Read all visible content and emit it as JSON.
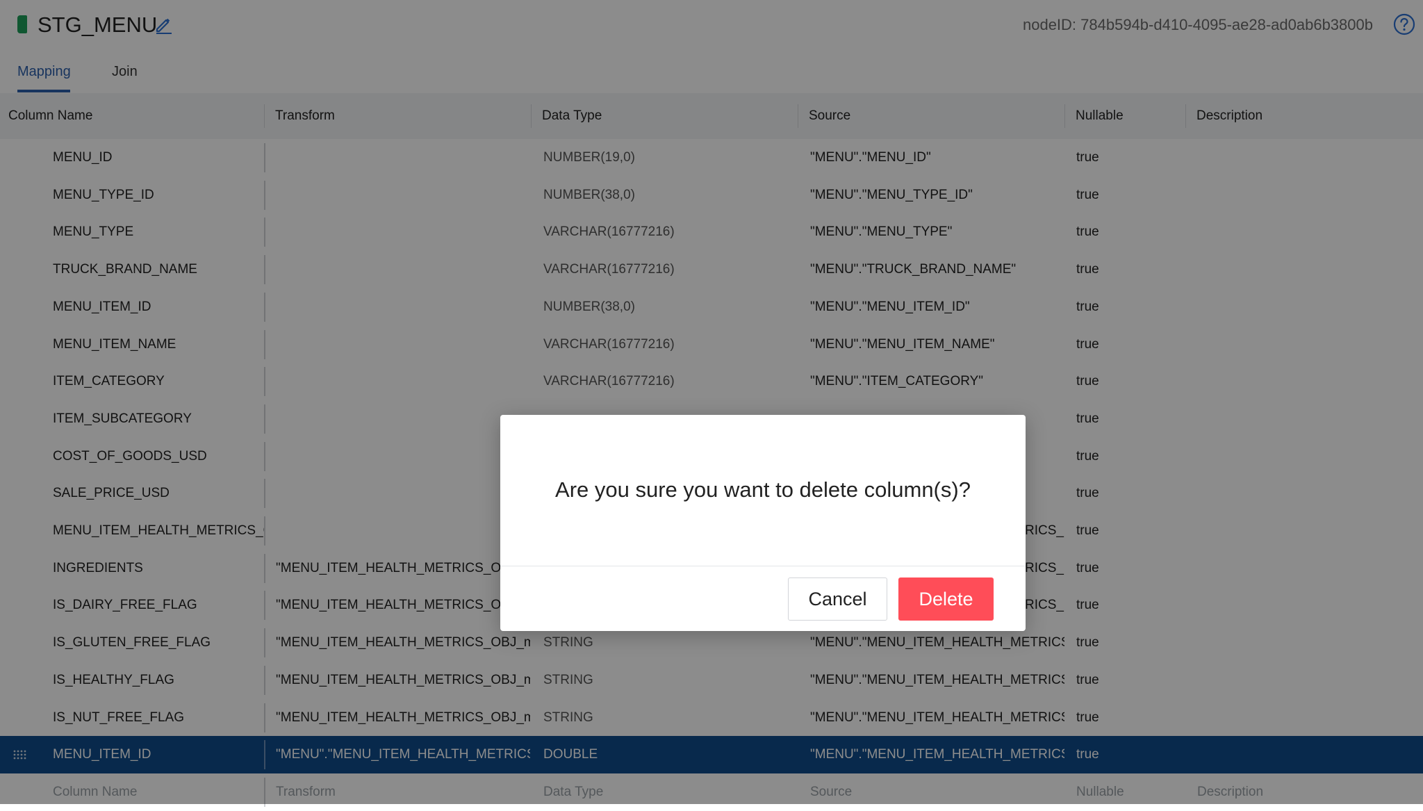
{
  "header": {
    "title": "STG_MENU",
    "node_id": "nodeID: 784b594b-d410-4095-ae28-ad0ab6b3800b",
    "accent_color": "#1e9e5a",
    "edit_icon": "pencil-icon",
    "help_icon": "help-circle-icon"
  },
  "tabs": [
    {
      "label": "Mapping",
      "active": true
    },
    {
      "label": "Join",
      "active": false
    }
  ],
  "table": {
    "columns": [
      "Column Name",
      "Transform",
      "Data Type",
      "Source",
      "Nullable",
      "Description"
    ],
    "rows": [
      {
        "name": "MENU_ID",
        "transform": "",
        "type": "NUMBER(19,0)",
        "source": "\"MENU\".\"MENU_ID\"",
        "nullable": "true",
        "description": ""
      },
      {
        "name": "MENU_TYPE_ID",
        "transform": "",
        "type": "NUMBER(38,0)",
        "source": "\"MENU\".\"MENU_TYPE_ID\"",
        "nullable": "true",
        "description": ""
      },
      {
        "name": "MENU_TYPE",
        "transform": "",
        "type": "VARCHAR(16777216)",
        "source": "\"MENU\".\"MENU_TYPE\"",
        "nullable": "true",
        "description": ""
      },
      {
        "name": "TRUCK_BRAND_NAME",
        "transform": "",
        "type": "VARCHAR(16777216)",
        "source": "\"MENU\".\"TRUCK_BRAND_NAME\"",
        "nullable": "true",
        "description": ""
      },
      {
        "name": "MENU_ITEM_ID",
        "transform": "",
        "type": "NUMBER(38,0)",
        "source": "\"MENU\".\"MENU_ITEM_ID\"",
        "nullable": "true",
        "description": ""
      },
      {
        "name": "MENU_ITEM_NAME",
        "transform": "",
        "type": "VARCHAR(16777216)",
        "source": "\"MENU\".\"MENU_ITEM_NAME\"",
        "nullable": "true",
        "description": ""
      },
      {
        "name": "ITEM_CATEGORY",
        "transform": "",
        "type": "VARCHAR(16777216)",
        "source": "\"MENU\".\"ITEM_CATEGORY\"",
        "nullable": "true",
        "description": ""
      },
      {
        "name": "ITEM_SUBCATEGORY",
        "transform": "",
        "type": "",
        "source": "",
        "nullable": "true",
        "description": ""
      },
      {
        "name": "COST_OF_GOODS_USD",
        "transform": "",
        "type": "",
        "source": "",
        "nullable": "true",
        "description": ""
      },
      {
        "name": "SALE_PRICE_USD",
        "transform": "",
        "type": "",
        "source": "",
        "nullable": "true",
        "description": ""
      },
      {
        "name": "MENU_ITEM_HEALTH_METRICS_OE",
        "transform": "",
        "type": "",
        "source": "RICS_(",
        "nullable": "true",
        "description": ""
      },
      {
        "name": "INGREDIENTS",
        "transform": "\"MENU_ITEM_HEALTH_METRICS_OBJ",
        "type": "",
        "source": "RICS_(",
        "nullable": "true",
        "description": ""
      },
      {
        "name": "IS_DAIRY_FREE_FLAG",
        "transform": "\"MENU_ITEM_HEALTH_METRICS_OBJ",
        "type": "",
        "source": "RICS_(",
        "nullable": "true",
        "description": ""
      },
      {
        "name": "IS_GLUTEN_FREE_FLAG",
        "transform": "\"MENU_ITEM_HEALTH_METRICS_OBJ_mer",
        "type": "STRING",
        "source": "\"MENU\".\"MENU_ITEM_HEALTH_METRICS_(",
        "nullable": "true",
        "description": ""
      },
      {
        "name": "IS_HEALTHY_FLAG",
        "transform": "\"MENU_ITEM_HEALTH_METRICS_OBJ_mer",
        "type": "STRING",
        "source": "\"MENU\".\"MENU_ITEM_HEALTH_METRICS_(",
        "nullable": "true",
        "description": ""
      },
      {
        "name": "IS_NUT_FREE_FLAG",
        "transform": "\"MENU_ITEM_HEALTH_METRICS_OBJ_mer",
        "type": "STRING",
        "source": "\"MENU\".\"MENU_ITEM_HEALTH_METRICS_(",
        "nullable": "true",
        "description": ""
      },
      {
        "name": "MENU_ITEM_ID",
        "transform": "\"MENU\".\"MENU_ITEM_HEALTH_METRICS_(",
        "type": "DOUBLE",
        "source": "\"MENU\".\"MENU_ITEM_HEALTH_METRICS_(",
        "nullable": "true",
        "description": "",
        "selected": true
      }
    ],
    "new_row": {
      "name_placeholder": "Column Name",
      "transform_placeholder": "Transform",
      "type_placeholder": "Data Type",
      "source_placeholder": "Source",
      "nullable_placeholder": "Nullable",
      "description_placeholder": "Description"
    },
    "selected_row_color": "#0f4c8a",
    "drag_icon": "drag-handle-icon"
  },
  "dialog": {
    "message": "Are you sure you want to delete column(s)?",
    "cancel_label": "Cancel",
    "delete_label": "Delete",
    "delete_color": "#ff4d58"
  }
}
